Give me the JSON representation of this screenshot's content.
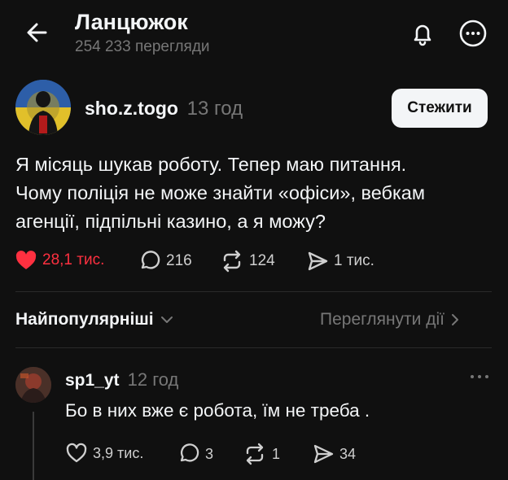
{
  "header": {
    "title": "Ланцюжок",
    "views": "254 233 перегляди",
    "icons": [
      "back-arrow-icon",
      "bell-icon",
      "more-icon"
    ]
  },
  "post": {
    "username": "sho.z.togo",
    "time": "13 год",
    "follow_label": "Стежити",
    "text_lines": [
      "Я місяць шукав роботу. Тепер маю питання.",
      "Чому поліція не може знайти «офіси», вебкам",
      "агенції, підпільні казино, а я можу?"
    ],
    "likes": "28,1 тис.",
    "replies": "216",
    "reposts": "124",
    "shares": "1 тис.",
    "liked": true,
    "like_color": "#ff3040"
  },
  "replies_bar": {
    "sort_label": "Найпопулярніші",
    "view_activity_label": "Переглянути дії"
  },
  "reply": {
    "username": "sp1_yt",
    "time": "12 год",
    "text": "Бо в них вже є робота, їм не треба .",
    "likes": "3,9 тис.",
    "replies": "3",
    "reposts": "1",
    "shares": "34"
  },
  "colors": {
    "background": "#101010",
    "text": "#f3f5f7",
    "muted": "#777777",
    "like": "#ff3040"
  }
}
